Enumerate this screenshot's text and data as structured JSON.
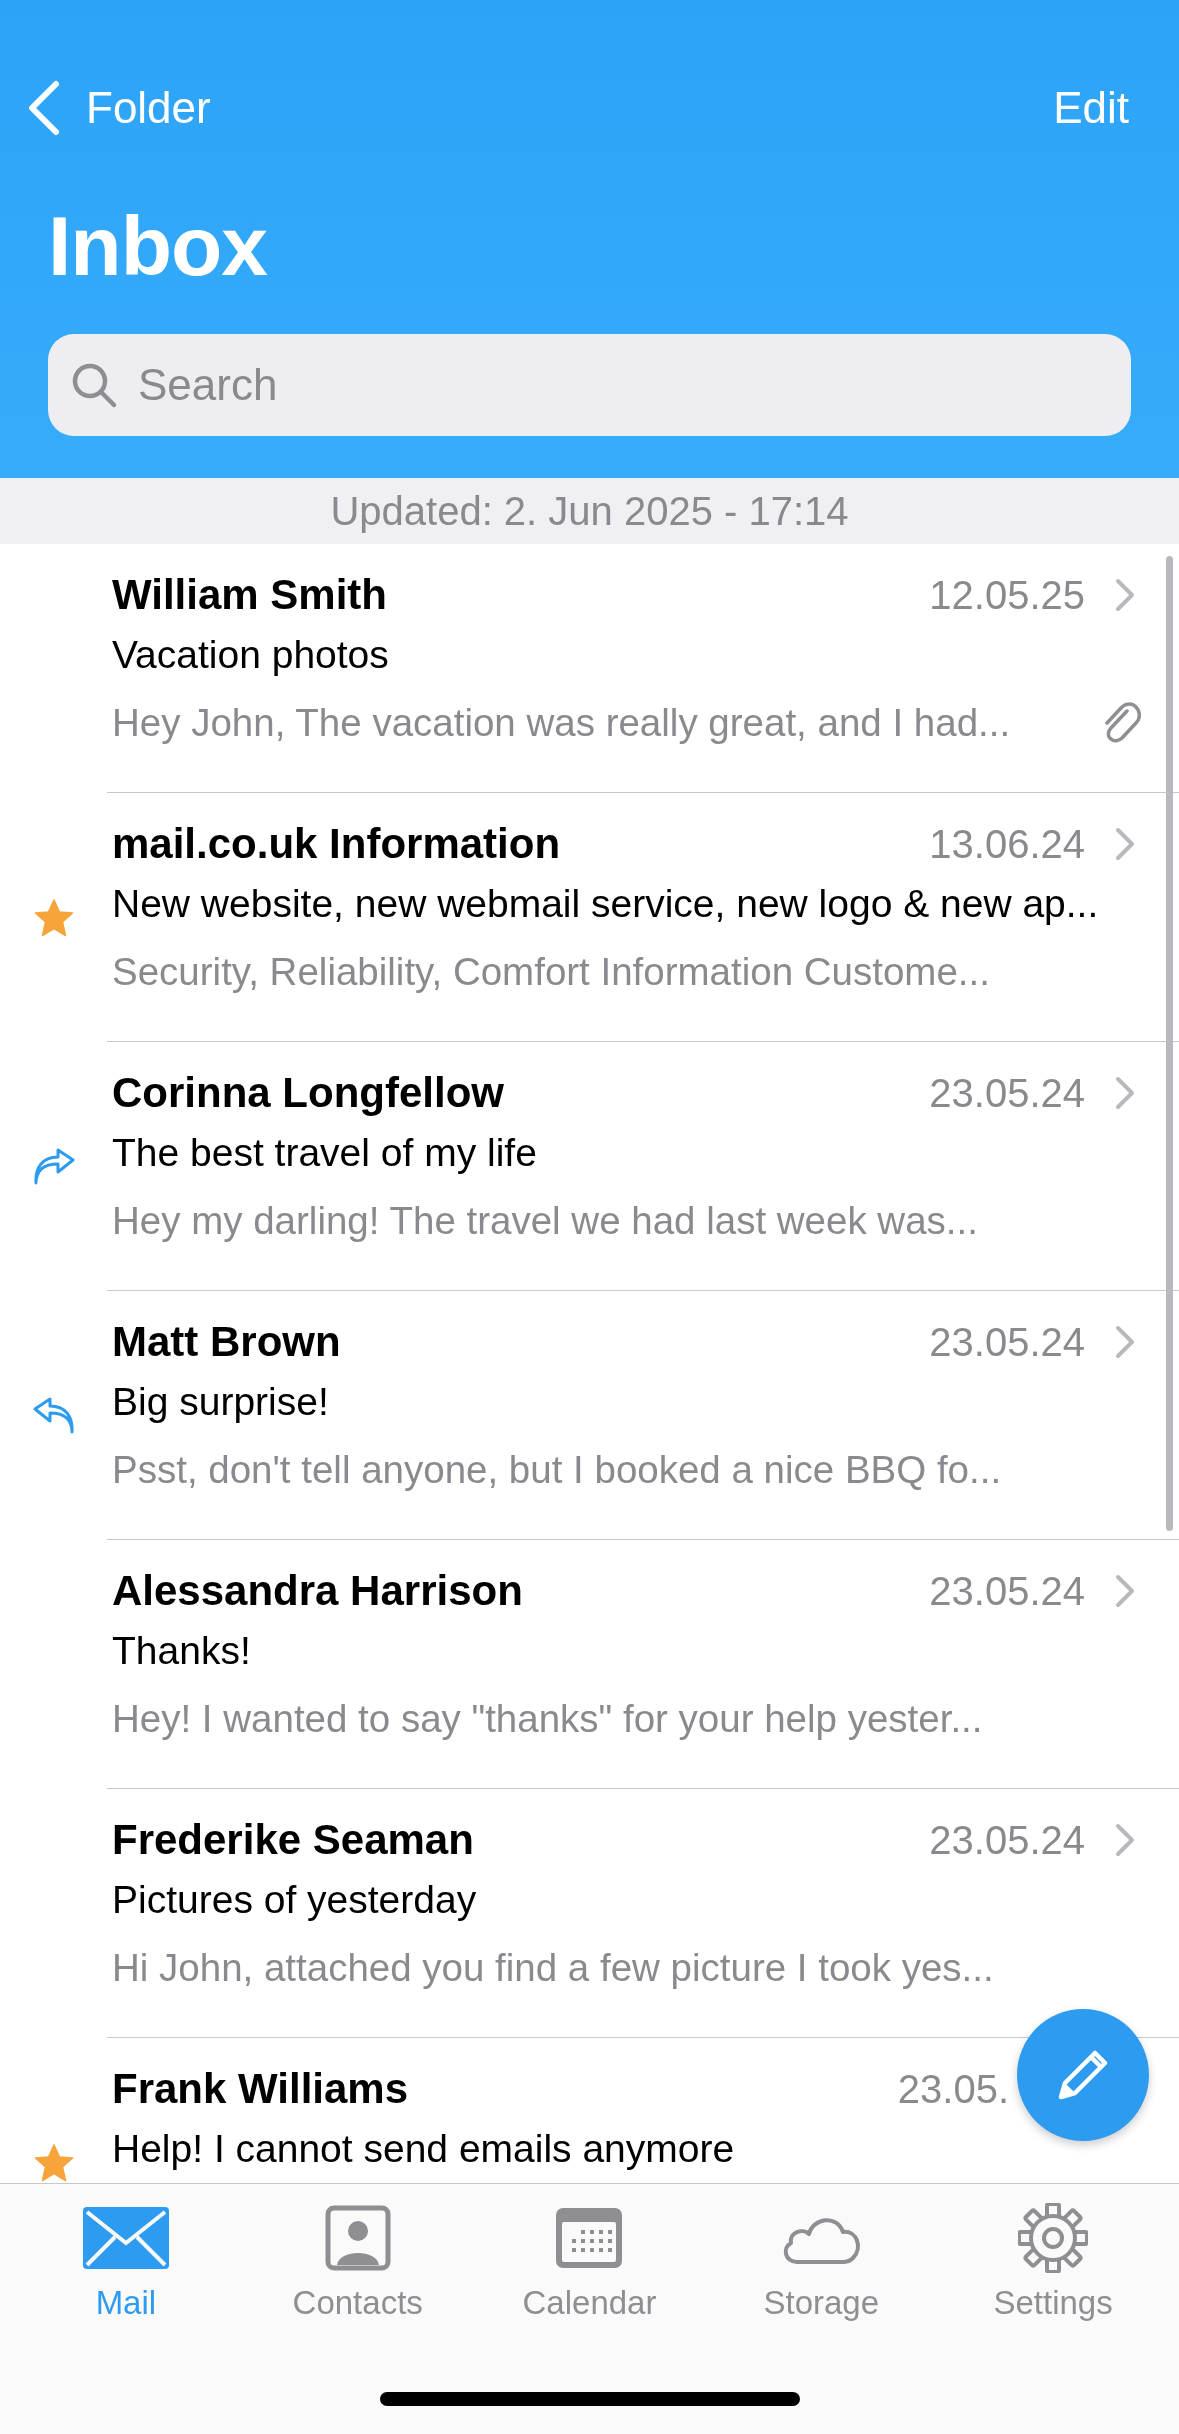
{
  "nav": {
    "back_label": "Folder",
    "action": "Edit"
  },
  "title": "Inbox",
  "search": {
    "placeholder": "Search"
  },
  "updated": "Updated: 2. Jun 2025 - 17:14",
  "messages": [
    {
      "sender": "William Smith",
      "date": "12.05.25",
      "subject": "Vacation photos",
      "preview": "Hey John, The vacation was really great, and I had...",
      "kind": "plain",
      "attachment": true,
      "chevron": true
    },
    {
      "sender": "mail.co.uk Information",
      "date": "13.06.24",
      "subject": "New website, new webmail service, new logo & new ap...",
      "preview": "Security, Reliability, Comfort Information Custome...",
      "kind": "starred",
      "attachment": false,
      "chevron": true
    },
    {
      "sender": "Corinna Longfellow",
      "date": "23.05.24",
      "subject": "The best travel of my life",
      "preview": "Hey my darling! The travel we had last week was...",
      "kind": "forwarded",
      "attachment": false,
      "chevron": true
    },
    {
      "sender": "Matt Brown",
      "date": "23.05.24",
      "subject": "Big surprise!",
      "preview": "Psst, don't tell anyone, but I booked a nice BBQ fo...",
      "kind": "replied",
      "attachment": false,
      "chevron": true
    },
    {
      "sender": "Alessandra Harrison",
      "date": "23.05.24",
      "subject": "Thanks!",
      "preview": "Hey! I wanted to say \"thanks\" for your help yester...",
      "kind": "plain",
      "attachment": false,
      "chevron": true
    },
    {
      "sender": "Frederike Seaman",
      "date": "23.05.24",
      "subject": "Pictures of yesterday",
      "preview": "Hi John, attached you find a few picture I took yes...",
      "kind": "plain",
      "attachment": false,
      "chevron": true
    },
    {
      "sender": "Frank Williams",
      "date": "23.05.",
      "subject": "Help! I cannot send emails anymore",
      "kind": "starred",
      "chevron": false
    }
  ],
  "tabs": [
    {
      "label": "Mail",
      "kind": "mail",
      "selected": true
    },
    {
      "label": "Contacts",
      "kind": "contacts",
      "selected": false
    },
    {
      "label": "Calendar",
      "kind": "calendar",
      "selected": false
    },
    {
      "label": "Storage",
      "kind": "storage",
      "selected": false
    },
    {
      "label": "Settings",
      "kind": "settings",
      "selected": false
    }
  ]
}
